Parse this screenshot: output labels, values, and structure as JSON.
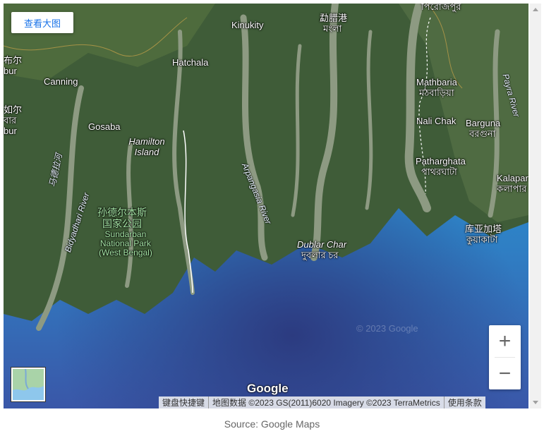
{
  "buttons": {
    "view_large": "查看大图"
  },
  "map": {
    "places": [
      {
        "key": "kinukity",
        "text": "Kinukity"
      },
      {
        "key": "hatchala",
        "text": "Hatchala"
      },
      {
        "key": "canning",
        "text": "Canning"
      },
      {
        "key": "gosaba",
        "text": "Gosaba"
      },
      {
        "key": "hamilton",
        "text": "Hamilton Island"
      },
      {
        "key": "mathbaria",
        "text": "Mathbaria"
      },
      {
        "key": "mathbaria_bn",
        "text": "মঠবাড়িয়া"
      },
      {
        "key": "nali_chak",
        "text": "Nali Chak"
      },
      {
        "key": "barguna",
        "text": "Barguna"
      },
      {
        "key": "barguna_bn",
        "text": "বরগুনা"
      },
      {
        "key": "patharghata",
        "text": "Patharghata"
      },
      {
        "key": "patharghata_bn",
        "text": "পাথরঘাটা"
      },
      {
        "key": "kalapara",
        "text": "Kalapar"
      },
      {
        "key": "kalapara_bn",
        "text": "কলাপার"
      },
      {
        "key": "kuakata",
        "text": "库亚加塔"
      },
      {
        "key": "kuakata_bn",
        "text": "কুয়াকাটা"
      },
      {
        "key": "dublar_char",
        "text": "Dublar Char"
      },
      {
        "key": "dublar_char_bn",
        "text": "দুবলার চর"
      },
      {
        "key": "mongla",
        "text": "勐腊港"
      },
      {
        "key": "mongla_bn",
        "text": "মংলা"
      },
      {
        "key": "pirojpur_bn",
        "text": "পিরোজপুর"
      },
      {
        "key": "left1",
        "text": "布尔"
      },
      {
        "key": "left2",
        "text": "bur"
      },
      {
        "key": "left3",
        "text": "如尔"
      },
      {
        "key": "left4",
        "text": "বার"
      },
      {
        "key": "left5",
        "text": "bur"
      }
    ],
    "park": {
      "zh": "孙德尔本斯\n国家公园",
      "en": "Sundarban\nNational Park\n(West Bengal)"
    },
    "rivers": {
      "matla": "马德拉河",
      "bidyadhari": "Bidyadhari River",
      "arpangasia": "Arpangasia River",
      "payra": "Payra River"
    },
    "logo": "Google",
    "watermark": "© 2023 Google"
  },
  "zoom": {
    "in": "+",
    "out": "−"
  },
  "attribution": {
    "shortcuts": "键盘快捷键",
    "data": "地图数据 ©2023 GS(2011)6020 Imagery ©2023 TerraMetrics",
    "terms": "使用条款"
  },
  "caption": "Source: Google Maps",
  "colors": {
    "land": "#3d5a37",
    "water": "#2a8fd0",
    "deep_water": "#3c4fa0",
    "river": "#8b9a7c",
    "link": "#1a73e8"
  }
}
